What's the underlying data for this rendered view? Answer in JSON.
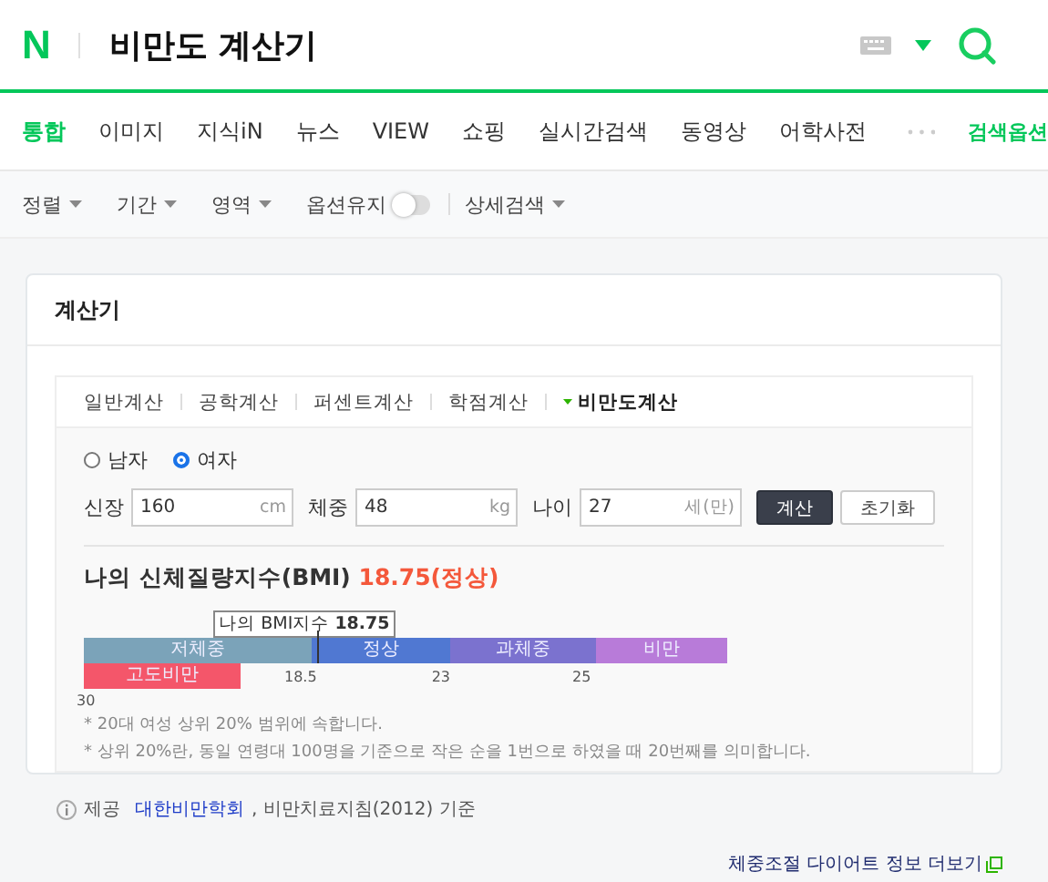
{
  "header": {
    "logo": "N",
    "query": "비만도 계산기"
  },
  "nav": {
    "tabs": [
      {
        "label": "통합",
        "selected": true
      },
      {
        "label": "이미지",
        "selected": false
      },
      {
        "label": "지식iN",
        "selected": false
      },
      {
        "label": "뉴스",
        "selected": false
      },
      {
        "label": "VIEW",
        "selected": false
      },
      {
        "label": "쇼핑",
        "selected": false
      },
      {
        "label": "실시간검색",
        "selected": false
      },
      {
        "label": "동영상",
        "selected": false
      },
      {
        "label": "어학사전",
        "selected": false
      }
    ],
    "options": "검색옵션"
  },
  "filters": {
    "items": [
      {
        "label": "정렬",
        "kind": "dropdown"
      },
      {
        "label": "기간",
        "kind": "dropdown"
      },
      {
        "label": "영역",
        "kind": "dropdown"
      },
      {
        "label": "옵션유지",
        "kind": "toggle",
        "on": false
      },
      {
        "label": "상세검색",
        "kind": "dropdown"
      }
    ]
  },
  "card": {
    "title": "계산기",
    "calc_tabs": [
      {
        "label": "일반계산",
        "selected": false
      },
      {
        "label": "공학계산",
        "selected": false
      },
      {
        "label": "퍼센트계산",
        "selected": false
      },
      {
        "label": "학점계산",
        "selected": false
      },
      {
        "label": "비만도계산",
        "selected": true
      }
    ],
    "gender": [
      {
        "label": "남자",
        "selected": false
      },
      {
        "label": "여자",
        "selected": true
      }
    ],
    "fields": [
      {
        "label": "신장",
        "value": "160",
        "unit": "cm"
      },
      {
        "label": "체중",
        "value": "48",
        "unit": "kg"
      },
      {
        "label": "나이",
        "value": "27",
        "unit": "세(만)"
      }
    ],
    "buttons": [
      {
        "label": "계산",
        "kind": "primary"
      },
      {
        "label": "초기화",
        "kind": "secondary"
      }
    ],
    "result": {
      "label": "나의 신체질량지수(BMI)",
      "value": "18.75(정상)"
    },
    "marker": {
      "label": "나의 BMI지수",
      "value": "18.75",
      "level": 0.363
    },
    "segments": [
      {
        "label": "저체중",
        "color": "#7ba3b9"
      },
      {
        "label": "정상",
        "color": "#5078d2"
      },
      {
        "label": "과체중",
        "color": "#7b72cf"
      },
      {
        "label": "비만",
        "color": "#b87bd9"
      },
      {
        "label": "고도비만",
        "color": "#f4566a"
      }
    ],
    "ticks": [
      "18.5",
      "23",
      "25",
      "30"
    ],
    "notes": [
      "* 20대 여성 상위 20% 범위에 속합니다.",
      "* 상위 20%란, 동일 연령대 100명을 기준으로 작은 순을 1번으로 하였을 때 20번째를 의미합니다."
    ]
  },
  "source": {
    "prefix": "제공",
    "link": "대한비만학회",
    "rest": ", 비만치료지침(2012) 기준"
  },
  "more_link": "체중조절 다이어트 정보 더보기"
}
